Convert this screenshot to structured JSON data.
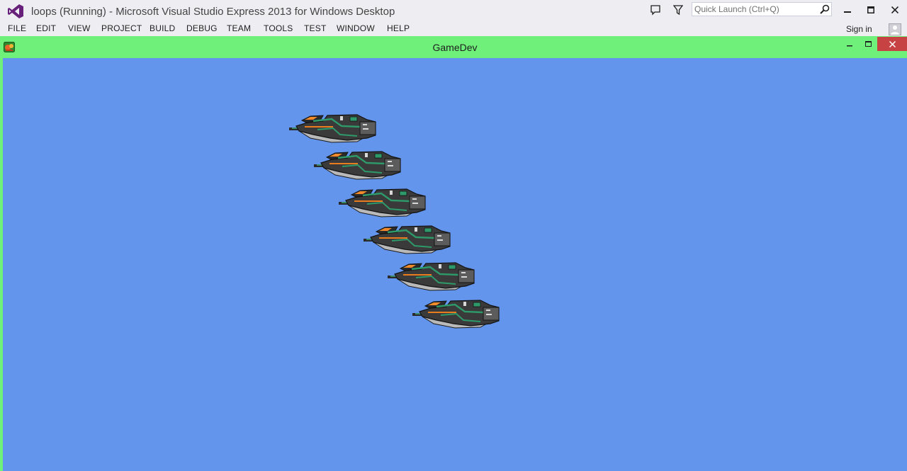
{
  "vs": {
    "window_title": "loops (Running) - Microsoft Visual Studio Express 2013 for Windows Desktop",
    "quick_launch": {
      "placeholder": "Quick Launch (Ctrl+Q)",
      "value": ""
    },
    "menu": [
      "FILE",
      "EDIT",
      "VIEW",
      "PROJECT",
      "BUILD",
      "DEBUG",
      "TEAM",
      "TOOLS",
      "TEST",
      "WINDOW",
      "HELP"
    ],
    "sign_in": "Sign in",
    "accent_color": "#68217a"
  },
  "game": {
    "window_title": "GameDev",
    "titlebar_color": "#6ff07a",
    "background_color": "#6495ed",
    "close_color": "#c74343",
    "ship_count": 6
  }
}
